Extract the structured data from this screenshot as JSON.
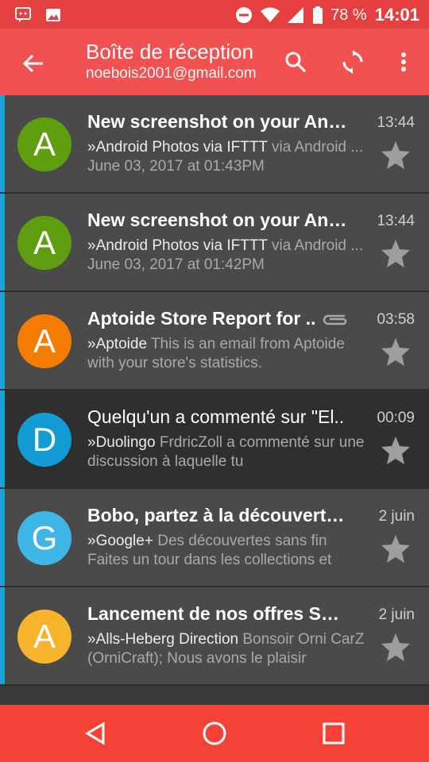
{
  "status": {
    "battery": "78 %",
    "time": "14:01"
  },
  "header": {
    "title": "Boîte de réception",
    "account": "noebois2001@gmail.com"
  },
  "emails": [
    {
      "avatar": "A",
      "avatar_color": "#5f9e0f",
      "subject": "New screenshot on your Android",
      "from": "»Android Photos via IFTTT",
      "preview": " via Android ... June 03, 2017 at 01:43PM",
      "time": "13:44",
      "read": false,
      "attachment": false
    },
    {
      "avatar": "A",
      "avatar_color": "#5f9e0f",
      "subject": "New screenshot on your Android",
      "from": "»Android Photos via IFTTT",
      "preview": " via Android ... June 03, 2017 at 01:42PM",
      "time": "13:44",
      "read": false,
      "attachment": false
    },
    {
      "avatar": "A",
      "avatar_color": "#f57c00",
      "subject": "Aptoide Store Report for ..",
      "from": "»Aptoide",
      "preview": " This is an email from Aptoide with your store's statistics.",
      "time": "03:58",
      "read": false,
      "attachment": true
    },
    {
      "avatar": "D",
      "avatar_color": "#139bd4",
      "subject": "Quelqu'un a commenté sur \"El..",
      "from": "»Duolingo",
      "preview": " FrdricZoll a commenté sur une discussion à laquelle tu",
      "time": "00:09",
      "read": true,
      "attachment": false
    },
    {
      "avatar": "G",
      "avatar_color": "#3fb7e6",
      "subject": "Bobo, partez à la découverte ..",
      "from": "»Google+",
      "preview": " Des découvertes sans fin Faites un tour dans les collections et",
      "time": "2 juin",
      "read": false,
      "attachment": false
    },
    {
      "avatar": "A",
      "avatar_color": "#f7b32b",
      "subject": "Lancement de nos offres SSD..",
      "from": "»Alls-Heberg Direction",
      "preview": " Bonsoir Orni CarZ (OrniCraft); Nous avons le plaisir",
      "time": "2 juin",
      "read": false,
      "attachment": false
    }
  ]
}
